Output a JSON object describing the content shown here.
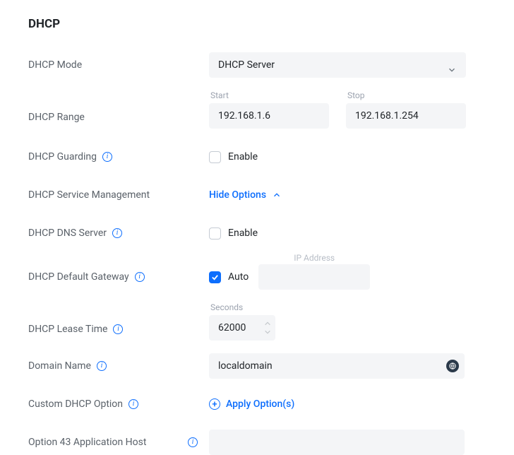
{
  "section_title": "DHCP",
  "dhcp_mode": {
    "label": "DHCP Mode",
    "value": "DHCP Server"
  },
  "dhcp_range": {
    "label": "DHCP Range",
    "start_label": "Start",
    "stop_label": "Stop",
    "start_value": "192.168.1.6",
    "stop_value": "192.168.1.254"
  },
  "dhcp_guarding": {
    "label": "DHCP Guarding",
    "enable_label": "Enable",
    "checked": false
  },
  "dhcp_service_management": {
    "label": "DHCP Service Management",
    "action_label": "Hide Options"
  },
  "dhcp_dns_server": {
    "label": "DHCP DNS Server",
    "enable_label": "Enable",
    "checked": false
  },
  "dhcp_default_gateway": {
    "label": "DHCP Default Gateway",
    "auto_label": "Auto",
    "auto_checked": true,
    "ip_placeholder": "IP Address",
    "ip_value": ""
  },
  "dhcp_lease_time": {
    "label": "DHCP Lease Time",
    "unit_label": "Seconds",
    "value": "62000"
  },
  "domain_name": {
    "label": "Domain Name",
    "value": "localdomain"
  },
  "custom_dhcp_option": {
    "label": "Custom DHCP Option",
    "action_label": "Apply Option(s)"
  },
  "option_43": {
    "label": "Option 43 Application Host",
    "value": ""
  }
}
